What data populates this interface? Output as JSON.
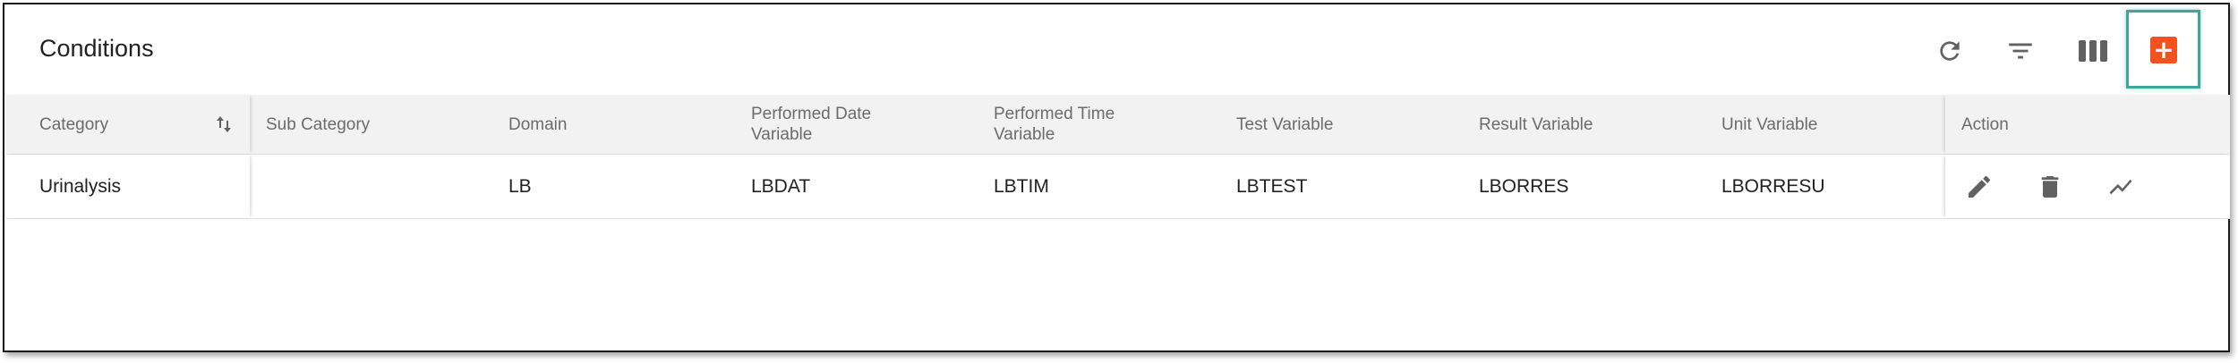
{
  "header": {
    "title": "Conditions"
  },
  "toolbar": {
    "refresh_icon": "refresh-icon",
    "filter_icon": "filter-icon",
    "columns_icon": "columns-icon",
    "add_icon": "add-icon",
    "add_label": "+",
    "accent_color": "#f4511e",
    "highlight_color": "#3aa89a"
  },
  "table": {
    "columns": [
      "Category",
      "Sub Category",
      "Domain",
      "Performed Date Variable",
      "Performed Time Variable",
      "Test Variable",
      "Result Variable",
      "Unit Variable",
      "Action"
    ],
    "sort_icon": "sort-icon",
    "rows": [
      {
        "category": "Urinalysis",
        "sub_category": "",
        "domain": "LB",
        "performed_date_variable": "LBDAT",
        "performed_time_variable": "LBTIM",
        "test_variable": "LBTEST",
        "result_variable": "LBORRES",
        "unit_variable": "LBORRESU",
        "actions": [
          "edit-icon",
          "delete-icon",
          "chart-icon"
        ]
      }
    ]
  }
}
